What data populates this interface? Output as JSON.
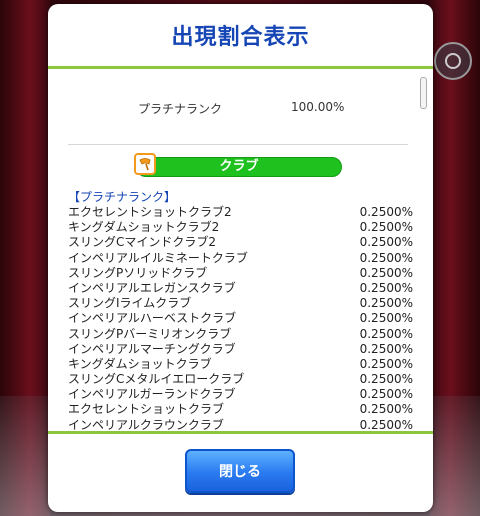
{
  "dialog": {
    "title": "出現割合表示",
    "summary": {
      "label": "プラチナランク",
      "value": "100.00%"
    },
    "category": {
      "label": "クラブ",
      "icon": "club-icon"
    },
    "section_title": "【プラチナランク】",
    "items": [
      {
        "name": "エクセレントショットクラブ2",
        "rate": "0.2500%"
      },
      {
        "name": "キングダムショットクラブ2",
        "rate": "0.2500%"
      },
      {
        "name": "スリングCマインドクラブ2",
        "rate": "0.2500%"
      },
      {
        "name": "インペリアルイルミネートクラブ",
        "rate": "0.2500%"
      },
      {
        "name": "スリングPソリッドクラブ",
        "rate": "0.2500%"
      },
      {
        "name": "インペリアルエレガンスクラブ",
        "rate": "0.2500%"
      },
      {
        "name": "スリングIライムクラブ",
        "rate": "0.2500%"
      },
      {
        "name": "インペリアルハーベストクラブ",
        "rate": "0.2500%"
      },
      {
        "name": "スリングPバーミリオンクラブ",
        "rate": "0.2500%"
      },
      {
        "name": "インペリアルマーチングクラブ",
        "rate": "0.2500%"
      },
      {
        "name": "キングダムショットクラブ",
        "rate": "0.2500%"
      },
      {
        "name": "スリングCメタルイエロークラブ",
        "rate": "0.2500%"
      },
      {
        "name": "インペリアルガーランドクラブ",
        "rate": "0.2500%"
      },
      {
        "name": "エクセレントショットクラブ",
        "rate": "0.2500%"
      },
      {
        "name": "インペリアルクラウンクラブ",
        "rate": "0.2500%"
      }
    ],
    "close_label": "閉じる"
  },
  "colors": {
    "title": "#1646b5",
    "accent_line": "#8cc63f",
    "category_bar": "#1fc11f",
    "button": "#2a7af0"
  }
}
